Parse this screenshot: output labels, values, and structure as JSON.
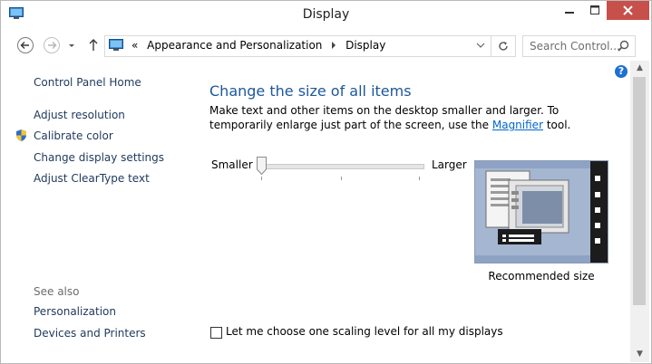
{
  "window": {
    "title": "Display",
    "minimize_icon": "minimize-icon",
    "maximize_icon": "maximize-icon",
    "close_icon": "close-icon"
  },
  "address": {
    "overflow": "«",
    "crumbs": [
      "Appearance and Personalization",
      "Display"
    ],
    "search_placeholder": "Search Control..."
  },
  "left_pane": {
    "home": "Control Panel Home",
    "links": [
      "Adjust resolution",
      "Calibrate color",
      "Change display settings",
      "Adjust ClearType text"
    ],
    "see_also_label": "See also",
    "see_also": [
      "Personalization",
      "Devices and Printers"
    ]
  },
  "main": {
    "heading": "Change the size of all items",
    "desc_before": "Make text and other items on the desktop smaller and larger. To temporarily enlarge just part of the screen, use the ",
    "desc_link": "Magnifier",
    "desc_after": " tool.",
    "slider_min_label": "Smaller",
    "slider_max_label": "Larger",
    "slider_value": 0,
    "preview_caption": "Recommended size",
    "checkbox_label": "Let me choose one scaling level for all my displays",
    "checkbox_checked": false
  },
  "colors": {
    "heading": "#1e5799",
    "link": "#0066cc",
    "close": "#c7504b"
  }
}
